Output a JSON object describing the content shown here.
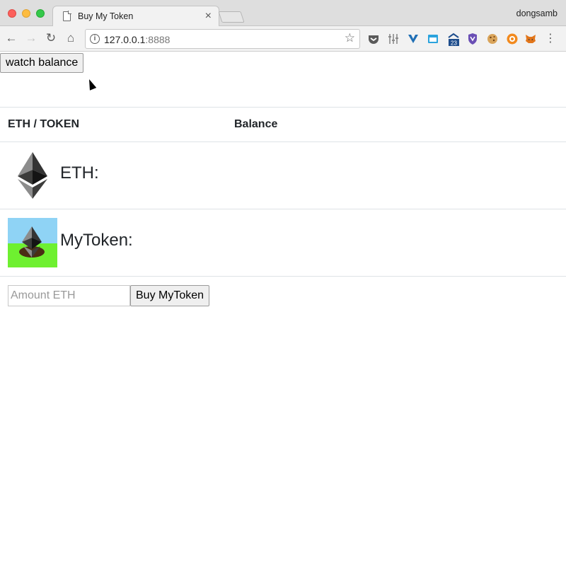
{
  "browser": {
    "tab_title": "Buy My Token",
    "tab_close": "×",
    "profile_name": "dongsamb",
    "url_host": "127.0.0.1",
    "url_port": ":8888",
    "back_glyph": "←",
    "forward_glyph": "→",
    "reload_glyph": "↻",
    "home_glyph": "⌂",
    "star_glyph": "☆",
    "menu_glyph": "⋮",
    "extension_icons": [
      "pocket-icon",
      "equalizer-icon",
      "vimium-icon",
      "window-icon",
      "calendar-23-icon",
      "shield-icon",
      "cookie-icon",
      "target-icon",
      "metamask-icon"
    ],
    "calendar_badge": "23"
  },
  "page": {
    "watch_button_label": "watch balance",
    "table": {
      "headers": [
        "ETH / TOKEN",
        "Balance"
      ],
      "rows": [
        {
          "token": "ETH:",
          "icon": "ethereum-icon",
          "balance": ""
        },
        {
          "token": "MyToken:",
          "icon": "mytoken-icon",
          "balance": ""
        }
      ]
    },
    "buy_form": {
      "amount_placeholder": "Amount ETH",
      "amount_value": "",
      "buy_button_label": "Buy MyToken"
    }
  }
}
